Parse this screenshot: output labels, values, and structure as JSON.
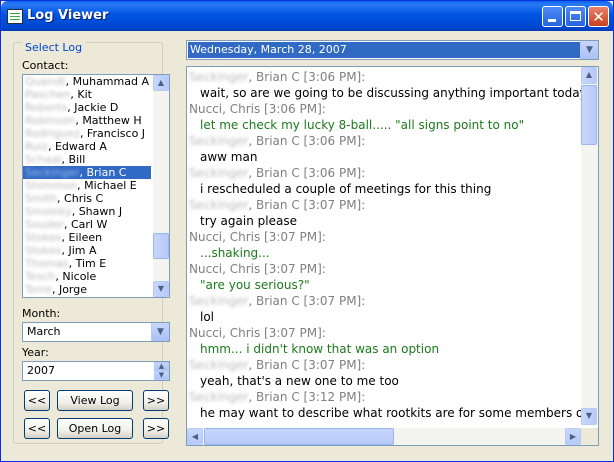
{
  "window": {
    "title": "Log Viewer",
    "minimize_icon": "minimize-icon",
    "maximize_icon": "maximize-icon",
    "close_icon": "close-icon",
    "close_glyph": "✕"
  },
  "select_log": {
    "legend": "Select Log",
    "contact_label": "Contact:",
    "contacts": [
      {
        "last": "Quandt",
        "first": ", Muhammad A"
      },
      {
        "last": "Paschen",
        "first": ", Kit"
      },
      {
        "last": "Roberts",
        "first": ", Jackie D"
      },
      {
        "last": "Robinson",
        "first": ", Matthew H"
      },
      {
        "last": "Rodriguez",
        "first": ", Francisco J"
      },
      {
        "last": "Ruiz",
        "first": ", Edward A"
      },
      {
        "last": "Schaal",
        "first": ", Bill"
      },
      {
        "last": "Seckinger",
        "first": ", Brian C"
      },
      {
        "last": "Shimmon",
        "first": ", Michael E"
      },
      {
        "last": "Smith",
        "first": ", Chris C"
      },
      {
        "last": "Smoloky",
        "first": ", Shawn J"
      },
      {
        "last": "Souder",
        "first": ", Carl W"
      },
      {
        "last": "Stokes",
        "first": ", Eileen"
      },
      {
        "last": "Stokes",
        "first": ", Jim A"
      },
      {
        "last": "Thomas",
        "first": ", Tim E"
      },
      {
        "last": "Tesch",
        "first": ", Nicole"
      },
      {
        "last": "Torre",
        "first": ", Jorge"
      }
    ],
    "selected_contact_index": 7,
    "month_label": "Month:",
    "month_value": "March",
    "year_label": "Year:",
    "year_value": "2007",
    "prev_label": "<<",
    "next_label": ">>",
    "view_log_label": "View Log",
    "open_log_label": "Open Log"
  },
  "log": {
    "date_value": "Wednesday, March 28, 2007",
    "messages": [
      {
        "name_blur": "Seckinger",
        "name": ", Brian C [3:06 PM]:",
        "text": "wait, so are we going to be discussing anything important today?",
        "self": true
      },
      {
        "name_blur": "",
        "name": "Nucci, Chris [3:06 PM]:",
        "text": "let me check my lucky 8-ball..... \"all signs point to no\"",
        "self": false
      },
      {
        "name_blur": "Seckinger",
        "name": ", Brian C [3:06 PM]:",
        "text": "aww man",
        "self": true
      },
      {
        "name_blur": "Seckinger",
        "name": ", Brian C [3:06 PM]:",
        "text": "i rescheduled a couple of meetings for this thing",
        "self": true
      },
      {
        "name_blur": "Seckinger",
        "name": ", Brian C [3:07 PM]:",
        "text": "try again please",
        "self": true
      },
      {
        "name_blur": "",
        "name": "Nucci, Chris [3:07 PM]:",
        "text": "...shaking...",
        "self": false
      },
      {
        "name_blur": "",
        "name": "Nucci, Chris [3:07 PM]:",
        "text": "\"are you serious?\"",
        "self": false
      },
      {
        "name_blur": "Seckinger",
        "name": ", Brian C [3:07 PM]:",
        "text": "lol",
        "self": true
      },
      {
        "name_blur": "",
        "name": "Nucci, Chris [3:07 PM]:",
        "text": "hmm... i didn't know that was an option",
        "self": false
      },
      {
        "name_blur": "Seckinger",
        "name": ", Brian C [3:07 PM]:",
        "text": "yeah, that's a new one to me too",
        "self": true
      },
      {
        "name_blur": "Seckinger",
        "name": ", Brian C [3:12 PM]:",
        "text": "he may want to describe what rootkits are for some members of t",
        "self": true
      }
    ]
  },
  "icons": {
    "up": "▲",
    "down": "▼",
    "left": "◀",
    "right": "▶"
  },
  "colors": {
    "selection": "#316AC5",
    "other_text": "#1B7A1B",
    "title_bar": "#0054E3"
  }
}
